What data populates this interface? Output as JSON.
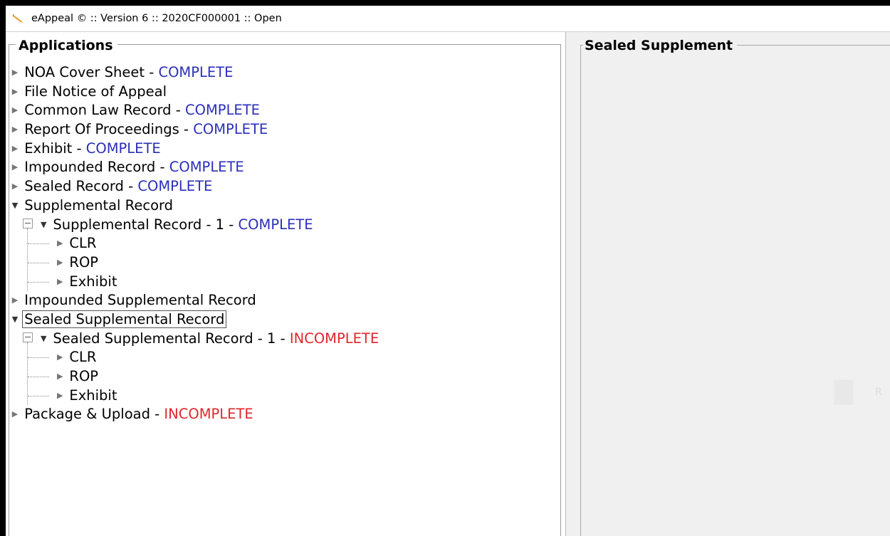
{
  "window": {
    "title": "eAppeal © :: Version 6 :: 2020CF000001 :: Open"
  },
  "left_panel": {
    "legend": "Applications"
  },
  "right_panel": {
    "legend": "Sealed Supplement",
    "ghost_text": "R"
  },
  "colors": {
    "complete": "#2b2fb8",
    "incomplete": "#e0262b"
  },
  "tree": {
    "items": [
      {
        "label": "NOA Cover Sheet",
        "status": "COMPLETE"
      },
      {
        "label": "File Notice of Appeal"
      },
      {
        "label": "Common Law Record",
        "status": "COMPLETE"
      },
      {
        "label": "Report Of Proceedings",
        "status": "COMPLETE"
      },
      {
        "label": "Exhibit",
        "status": "COMPLETE"
      },
      {
        "label": "Impounded Record",
        "status": "COMPLETE"
      },
      {
        "label": "Sealed Record",
        "status": "COMPLETE"
      },
      {
        "label": "Supplemental Record"
      },
      {
        "label": "Supplemental Record - 1",
        "status": "COMPLETE"
      },
      {
        "label": "CLR"
      },
      {
        "label": "ROP"
      },
      {
        "label": "Exhibit"
      },
      {
        "label": "Impounded Supplemental Record"
      },
      {
        "label": "Sealed Supplemental Record"
      },
      {
        "label": "Sealed Supplemental Record - 1",
        "status": "INCOMPLETE"
      },
      {
        "label": "CLR"
      },
      {
        "label": "ROP"
      },
      {
        "label": "Exhibit"
      },
      {
        "label": "Package & Upload",
        "status": "INCOMPLETE"
      }
    ],
    "separator": "-"
  },
  "icons": {
    "app": "pencil-icon",
    "collapsed": "triangle-right-icon",
    "expanded": "triangle-down-icon",
    "expander": "collapse-box-icon"
  }
}
